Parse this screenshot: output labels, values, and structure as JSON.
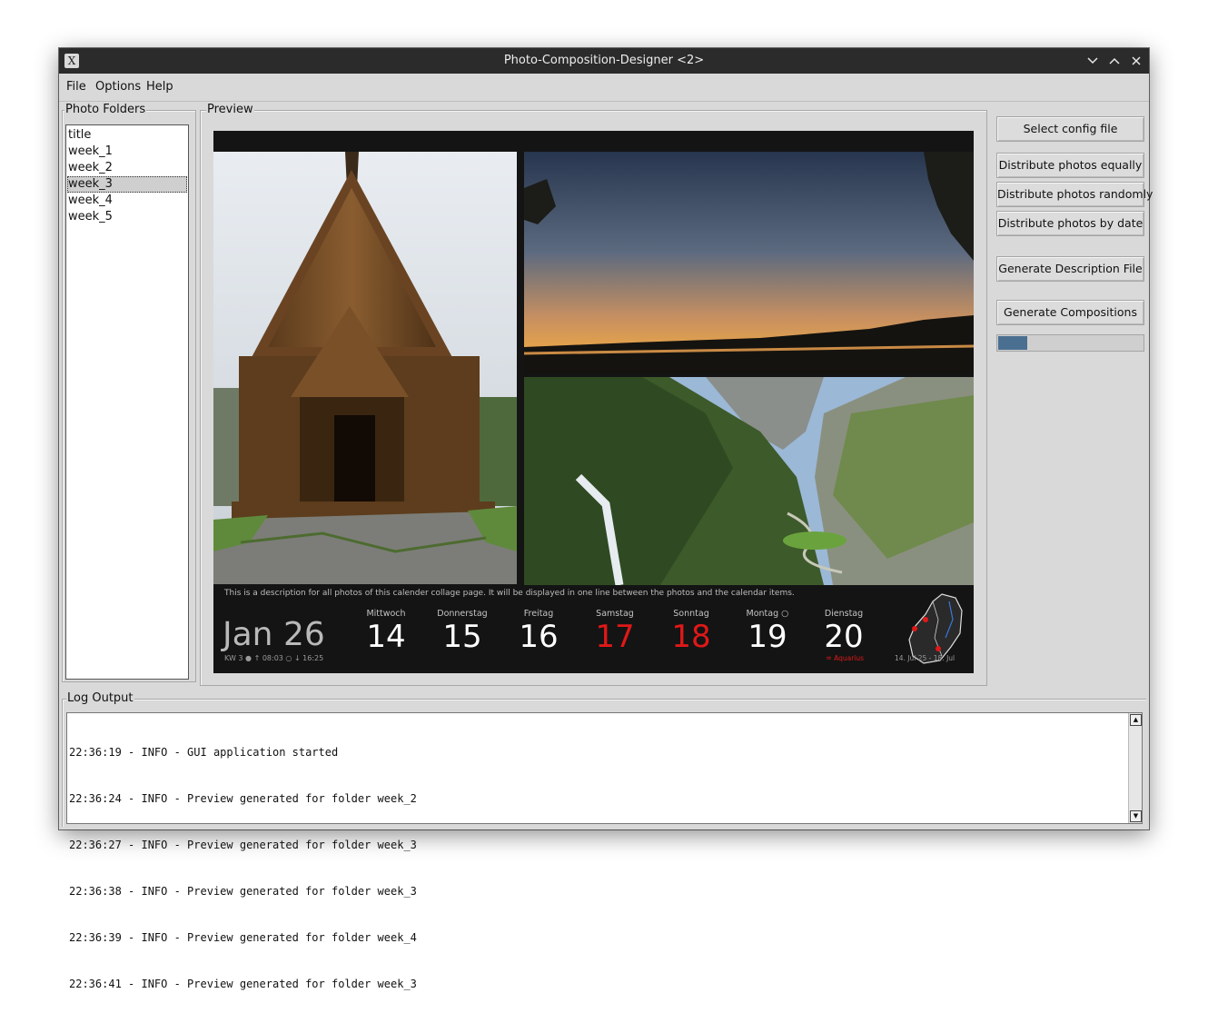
{
  "window": {
    "title": "Photo-Composition-Designer <2>",
    "app_icon": "X"
  },
  "menu": {
    "file": "File",
    "options": "Options",
    "help": "Help"
  },
  "folders": {
    "legend": "Photo Folders",
    "items": [
      "title",
      "week_1",
      "week_2",
      "week_3",
      "week_4",
      "week_5"
    ],
    "selected": "week_3"
  },
  "preview": {
    "legend": "Preview",
    "description": "This is a description for all photos of this calender collage page. It will be displayed in one line between the photos and the calendar items.",
    "month": "Jan 26",
    "month_sub": "KW 3 ● ↑ 08:03  ○ ↓ 16:25",
    "days": [
      {
        "name": "Mittwoch",
        "num": "14",
        "red": false
      },
      {
        "name": "Donnerstag",
        "num": "15",
        "red": false
      },
      {
        "name": "Freitag",
        "num": "16",
        "red": false
      },
      {
        "name": "Samstag",
        "num": "17",
        "red": true
      },
      {
        "name": "Sonntag",
        "num": "18",
        "red": true
      },
      {
        "name": "Montag ○",
        "num": "19",
        "red": false
      },
      {
        "name": "Dienstag",
        "num": "20",
        "red": false
      }
    ],
    "zodiac": "♒ Aquarius",
    "map_dates": "14. Jul 25 - 18. Jul"
  },
  "buttons": {
    "select_config": "Select config file",
    "distribute_equally": "Distribute photos equally",
    "distribute_randomly": "Distribute photos randomly",
    "distribute_by_date": "Distribute photos by date",
    "generate_description": "Generate Description File",
    "generate_compositions": "Generate Compositions"
  },
  "progress": {
    "value": 0.2
  },
  "log": {
    "legend": "Log Output",
    "lines": [
      "22:36:19 - INFO - GUI application started",
      "22:36:24 - INFO - Preview generated for folder week_2",
      "22:36:27 - INFO - Preview generated for folder week_3",
      "22:36:38 - INFO - Preview generated for folder week_3",
      "22:36:39 - INFO - Preview generated for folder week_4",
      "22:36:41 - INFO - Preview generated for folder week_3"
    ]
  },
  "icons": {
    "minimize": "chevron-down-icon",
    "maximize": "chevron-up-icon",
    "close": "close-icon"
  }
}
